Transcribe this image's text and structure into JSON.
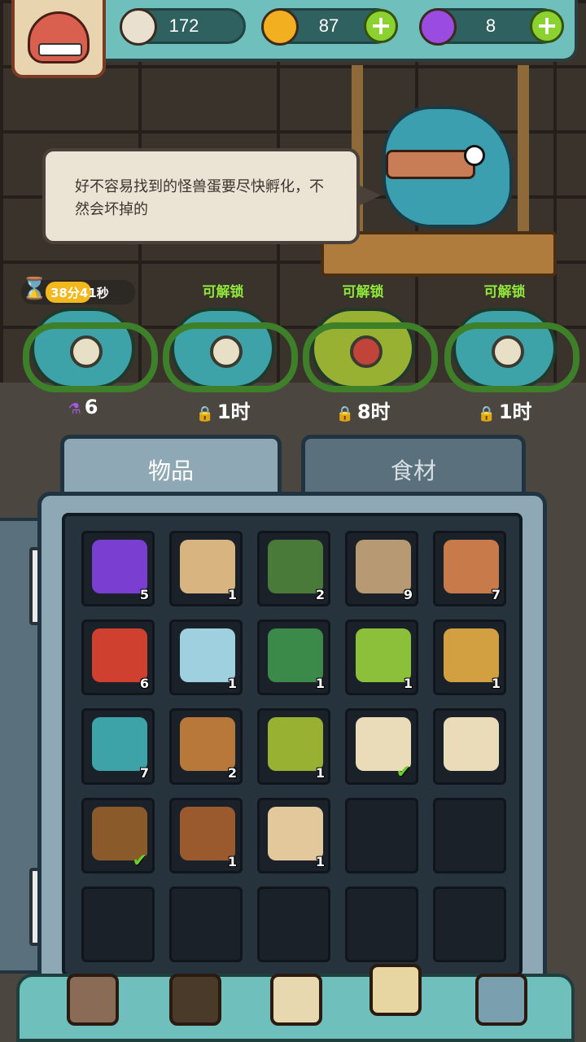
{
  "hud": {
    "eyeballs": "172",
    "coins": "87",
    "potions": "8"
  },
  "npc": {
    "speech": "好不容易找到的怪兽蛋要尽快孵化，不然会坏掉的"
  },
  "eggs": {
    "timer": "38分41秒",
    "slots": [
      {
        "top_label": "",
        "bottom": "6",
        "bottom_icon": "potion",
        "type": "spiral"
      },
      {
        "top_label": "可解锁",
        "bottom": "1时",
        "bottom_icon": "lock",
        "type": "spiral"
      },
      {
        "top_label": "可解锁",
        "bottom": "8时",
        "bottom_icon": "lock",
        "type": "mossy"
      },
      {
        "top_label": "可解锁",
        "bottom": "1时",
        "bottom_icon": "lock",
        "type": "spiral"
      }
    ]
  },
  "inventory": {
    "tabs": [
      "物品",
      "食材"
    ],
    "active_tab": "物品",
    "items": [
      {
        "name": "purple-powder",
        "count": "5",
        "color": "#7a3fd1"
      },
      {
        "name": "torn-map",
        "count": "1",
        "color": "#d8b480"
      },
      {
        "name": "picture-card",
        "count": "2",
        "color": "#4a7a3a"
      },
      {
        "name": "rope-snake",
        "count": "9",
        "color": "#b79a73"
      },
      {
        "name": "wooden-club",
        "count": "7",
        "color": "#c87a4a"
      },
      {
        "name": "red-spider",
        "count": "6",
        "color": "#d0402e"
      },
      {
        "name": "crystal-ball",
        "count": "1",
        "color": "#9ed0e0"
      },
      {
        "name": "green-plant",
        "count": "1",
        "color": "#3c8a4a"
      },
      {
        "name": "green-cones",
        "count": "1",
        "color": "#8cc03a"
      },
      {
        "name": "beetle-egg",
        "count": "1",
        "color": "#d2a040"
      },
      {
        "name": "spiral-egg",
        "count": "7",
        "color": "#3da3a8"
      },
      {
        "name": "stone-idol",
        "count": "2",
        "color": "#b8783a"
      },
      {
        "name": "mossy-egg",
        "count": "1",
        "color": "#99b133"
      },
      {
        "name": "scroll",
        "count": "",
        "color": "#eadcb8",
        "checked": true
      },
      {
        "name": "scroll",
        "count": "",
        "color": "#eadcb8"
      },
      {
        "name": "rune-tablet",
        "count": "",
        "color": "#8a5a2a",
        "checked": true
      },
      {
        "name": "leather-book",
        "count": "1",
        "color": "#9a5a2e"
      },
      {
        "name": "ticket",
        "count": "1",
        "color": "#e2c89a"
      },
      {
        "name": "",
        "count": ""
      },
      {
        "name": "",
        "count": ""
      },
      {
        "name": "",
        "count": ""
      },
      {
        "name": "",
        "count": ""
      },
      {
        "name": "",
        "count": ""
      },
      {
        "name": "",
        "count": ""
      },
      {
        "name": "",
        "count": ""
      }
    ]
  },
  "nav": [
    {
      "name": "shop",
      "color": "#8a6b56"
    },
    {
      "name": "monster-lair",
      "color": "#4a3a2a"
    },
    {
      "name": "book",
      "color": "#e8d8b0"
    },
    {
      "name": "bag",
      "color": "#e8d6a2",
      "active": true
    },
    {
      "name": "menu",
      "color": "#7aa0b0"
    }
  ],
  "colors": {
    "hud": "#6fbfbd",
    "unlock_green": "#8fe83a",
    "timer_gold": "#f2b81c"
  }
}
